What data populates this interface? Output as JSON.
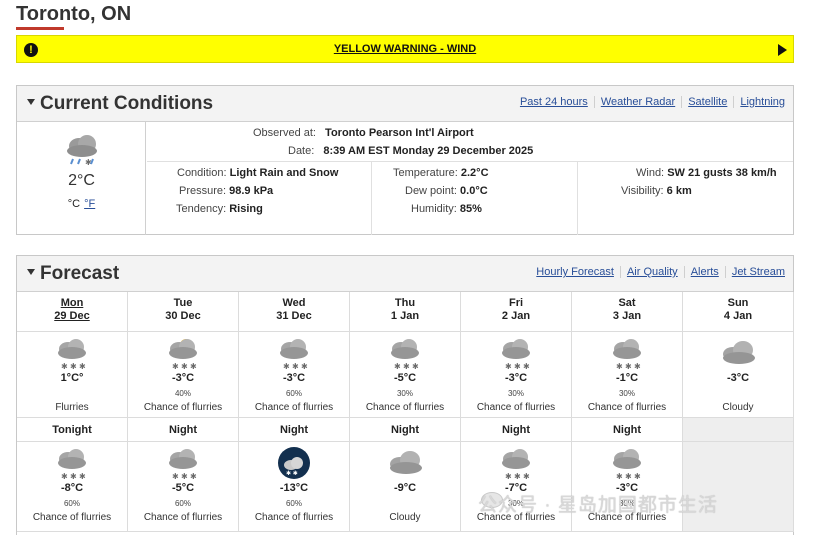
{
  "location": {
    "title": "Toronto, ON"
  },
  "warning": {
    "text": "YELLOW WARNING - WIND"
  },
  "current": {
    "title": "Current Conditions",
    "links": [
      "Past 24 hours",
      "Weather Radar",
      "Satellite",
      "Lightning"
    ],
    "temp": "2°C",
    "unit_c": "°C",
    "unit_f": "°F",
    "icon": "rain-snow-cloud-icon",
    "observed_label": "Observed at:",
    "observed_value": "Toronto Pearson Int'l Airport",
    "date_label": "Date:",
    "date_value": "8:39 AM EST Monday 29 December 2025",
    "condition_label": "Condition:",
    "condition_value": "Light Rain and Snow",
    "pressure_label": "Pressure:",
    "pressure_value": "98.9 kPa",
    "tendency_label": "Tendency:",
    "tendency_value": "Rising",
    "temperature_label": "Temperature:",
    "temperature_value": "2.2°C",
    "dewpoint_label": "Dew point:",
    "dewpoint_value": "0.0°C",
    "humidity_label": "Humidity:",
    "humidity_value": "85%",
    "wind_label": "Wind:",
    "wind_value": "SW 21 gusts 38 km/h",
    "visibility_label": "Visibility:",
    "visibility_value": "6 km"
  },
  "forecast": {
    "title": "Forecast",
    "links": [
      "Hourly Forecast",
      "Air Quality",
      "Alerts",
      "Jet Stream"
    ],
    "days": [
      {
        "name": "Mon",
        "date": "29 Dec",
        "temp": "1°C°",
        "pop": "",
        "summary": "Flurries",
        "icon": "snow-cloud-icon"
      },
      {
        "name": "Tue",
        "date": "30 Dec",
        "temp": "-3°C",
        "pop": "40%",
        "summary": "Chance of flurries",
        "icon": "sun-snow-cloud-icon"
      },
      {
        "name": "Wed",
        "date": "31 Dec",
        "temp": "-3°C",
        "pop": "60%",
        "summary": "Chance of flurries",
        "icon": "snow-cloud-icon"
      },
      {
        "name": "Thu",
        "date": "1 Jan",
        "temp": "-5°C",
        "pop": "30%",
        "summary": "Chance of flurries",
        "icon": "snow-cloud-icon"
      },
      {
        "name": "Fri",
        "date": "2 Jan",
        "temp": "-3°C",
        "pop": "30%",
        "summary": "Chance of flurries",
        "icon": "snow-cloud-icon"
      },
      {
        "name": "Sat",
        "date": "3 Jan",
        "temp": "-1°C",
        "pop": "30%",
        "summary": "Chance of flurries",
        "icon": "snow-cloud-icon"
      },
      {
        "name": "Sun",
        "date": "4 Jan",
        "temp": "-3°C",
        "pop": "",
        "summary": "Cloudy",
        "icon": "cloud-icon"
      }
    ],
    "nights": [
      {
        "name": "Tonight",
        "temp": "-8°C",
        "pop": "60%",
        "summary": "Chance of flurries",
        "icon": "snow-cloud-icon"
      },
      {
        "name": "Night",
        "temp": "-5°C",
        "pop": "60%",
        "summary": "Chance of flurries",
        "icon": "snow-cloud-icon"
      },
      {
        "name": "Night",
        "temp": "-13°C",
        "pop": "60%",
        "summary": "Chance of flurries",
        "icon": "moon-snow-icon"
      },
      {
        "name": "Night",
        "temp": "-9°C",
        "pop": "",
        "summary": "Cloudy",
        "icon": "cloud-icon"
      },
      {
        "name": "Night",
        "temp": "-7°C",
        "pop": "30%",
        "summary": "Chance of flurries",
        "icon": "snow-cloud-icon"
      },
      {
        "name": "Night",
        "temp": "-3°C",
        "pop": "30%",
        "summary": "Chance of flurries",
        "icon": "snow-cloud-icon"
      }
    ]
  },
  "watermark": {
    "text": "公众号 · 星岛加国都市生活"
  }
}
